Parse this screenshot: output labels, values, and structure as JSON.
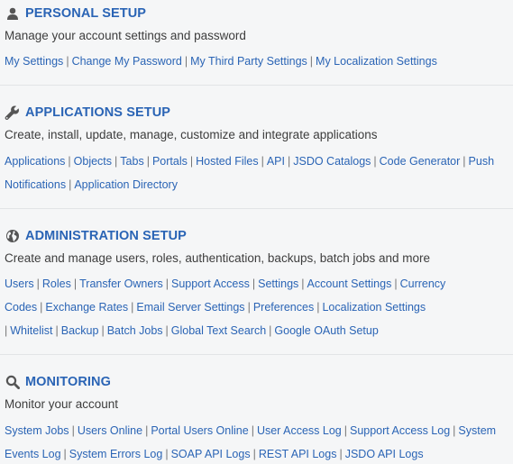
{
  "personal": {
    "title": "PERSONAL SETUP",
    "icon": "person-icon",
    "desc": "Manage your account settings and password",
    "links": [
      "My Settings",
      "Change My Password",
      "My Third Party Settings",
      "My Localization Settings"
    ]
  },
  "applications": {
    "title": "APPLICATIONS SETUP",
    "icon": "wrench-icon",
    "desc": "Create, install, update, manage, customize and integrate applications",
    "links": [
      "Applications",
      "Objects",
      "Tabs",
      "Portals",
      "Hosted Files",
      "API",
      "JSDO Catalogs",
      "Code Generator",
      "Push",
      "Notifications",
      "Application Directory"
    ]
  },
  "administration": {
    "title": "ADMINISTRATION SETUP",
    "icon": "globe-icon",
    "desc": "Create and manage users, roles, authentication, backups, batch jobs and more",
    "links": [
      "Users",
      "Roles",
      "Transfer Owners",
      "Support Access",
      "Settings",
      "Account Settings",
      "Currency",
      "Codes",
      "Exchange Rates",
      "Email Server Settings",
      "Preferences",
      "Localization Settings",
      "Whitelist",
      "Backup",
      "Batch Jobs",
      "Global Text Search",
      "Google OAuth Setup"
    ]
  },
  "monitoring": {
    "title": "MONITORING",
    "icon": "magnifier-icon",
    "desc": "Monitor your account",
    "links": [
      "System Jobs",
      "Users Online",
      "Portal Users Online",
      "User Access Log",
      "Support Access Log",
      "System",
      "Events Log",
      "System Errors Log",
      "SOAP API Logs",
      "REST API Logs",
      "JSDO API Logs"
    ]
  },
  "colors": {
    "accent": "#2a64b5",
    "text": "#3d3d3d",
    "background": "#f5f6f7"
  }
}
